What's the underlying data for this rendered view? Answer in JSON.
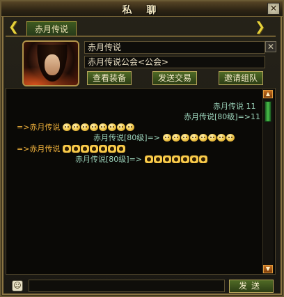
{
  "window": {
    "title": "私 聊",
    "close": "✕"
  },
  "tab": {
    "label": "赤月传说"
  },
  "profile": {
    "name": "赤月传说",
    "guild": "赤月传说公会<公会>",
    "x_label": "✕"
  },
  "actions": {
    "equip": "查看装备",
    "trade": "发送交易",
    "party": "邀请组队"
  },
  "chat": {
    "line1": {
      "text": "赤月传说  11"
    },
    "line2": {
      "text": "赤月传说[80级]=>11"
    },
    "line3": {
      "prefix": "=>赤月传说",
      "emote_count": 8
    },
    "line4": {
      "text": "赤月传说[80级]=>",
      "emote_count": 8
    },
    "line5": {
      "prefix": "=>赤月传说",
      "emote_count": 7
    },
    "line6": {
      "text": "赤月传说[80级]=>",
      "emote_count": 7
    }
  },
  "input": {
    "value": "",
    "send": "发送"
  },
  "colors": {
    "accent": "#f3b43d",
    "chat": "#9ed6bd",
    "button": "#4f6a25"
  }
}
